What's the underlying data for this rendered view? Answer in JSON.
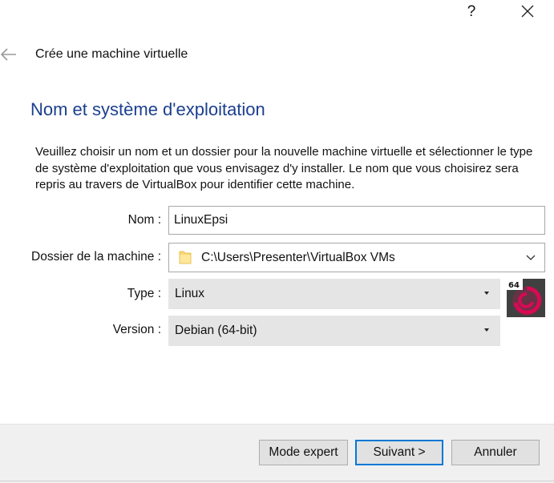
{
  "titlebar": {
    "help_label": "?",
    "close_icon": "close-icon"
  },
  "header": {
    "back_icon": "back-arrow-icon",
    "title": "Crée une machine virtuelle"
  },
  "section": {
    "title": "Nom et système d'exploitation",
    "description": "Veuillez choisir un nom et un dossier pour la nouvelle machine virtuelle et sélectionner le type de système d'exploitation que vous envisagez d'y installer. Le nom que vous choisirez sera repris au travers de VirtualBox pour identifier cette machine."
  },
  "form": {
    "name_label": "Nom :",
    "name_value": "LinuxEpsi",
    "folder_label": "Dossier de la machine :",
    "folder_value": "C:\\Users\\Presenter\\VirtualBox VMs",
    "folder_icon": "folder-icon",
    "type_label": "Type :",
    "type_value": "Linux",
    "version_label": "Version :",
    "version_value": "Debian (64-bit)",
    "os_icon": "debian-64-icon",
    "os_badge": "64"
  },
  "buttons": {
    "expert": "Mode expert",
    "next": "Suivant >",
    "cancel": "Annuler"
  },
  "colors": {
    "section_title": "#1b3f8f",
    "default_button_border": "#0078d7",
    "select_background": "#e5e5e5",
    "footer_background": "#f0f0f0",
    "debian_red": "#d70a53"
  }
}
